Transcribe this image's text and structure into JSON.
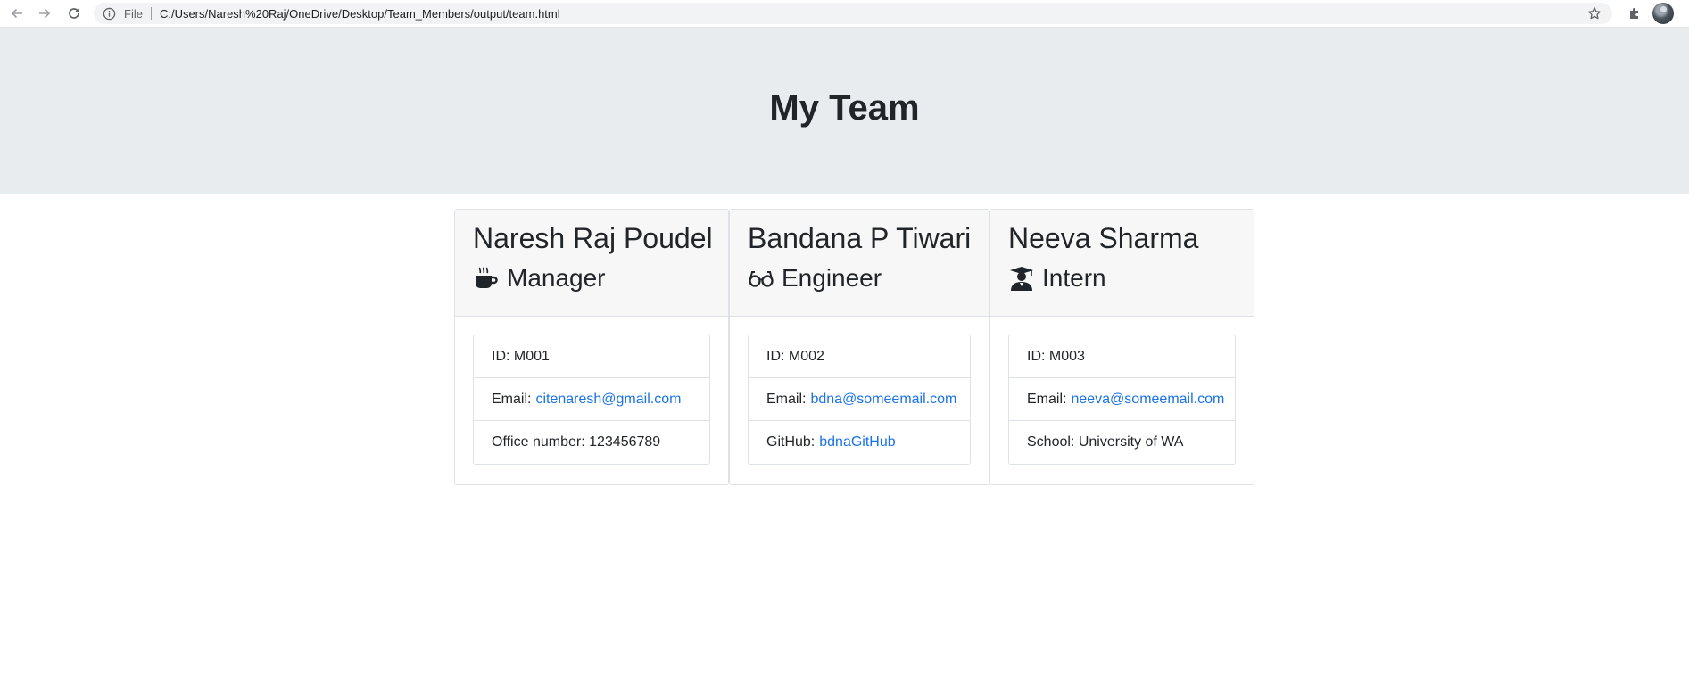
{
  "browser": {
    "scheme_label": "File",
    "url": "C:/Users/Naresh%20Raj/OneDrive/Desktop/Team_Members/output/team.html"
  },
  "header": {
    "title": "My Team"
  },
  "team": [
    {
      "name": "Naresh Raj Poudel",
      "role": "Manager",
      "icon": "coffee-mug-icon",
      "id_label": "ID:",
      "id": "M001",
      "email_label": "Email:",
      "email": "citenaresh@gmail.com",
      "extra_label": "Office number:",
      "extra_value": "123456789"
    },
    {
      "name": "Bandana P Tiwari",
      "role": "Engineer",
      "icon": "glasses-icon",
      "id_label": "ID:",
      "id": "M002",
      "email_label": "Email:",
      "email": "bdna@someemail.com",
      "extra_label": "GitHub:",
      "extra_value": "bdnaGitHub"
    },
    {
      "name": "Neeva Sharma",
      "role": "Intern",
      "icon": "graduate-icon",
      "id_label": "ID:",
      "id": "M003",
      "email_label": "Email:",
      "email": "neeva@someemail.com",
      "extra_label": "School:",
      "extra_value": "University of WA"
    }
  ],
  "colors": {
    "link": "#1a73e8",
    "jumbotron": "#e9ecef",
    "card_header": "#f7f7f7"
  }
}
